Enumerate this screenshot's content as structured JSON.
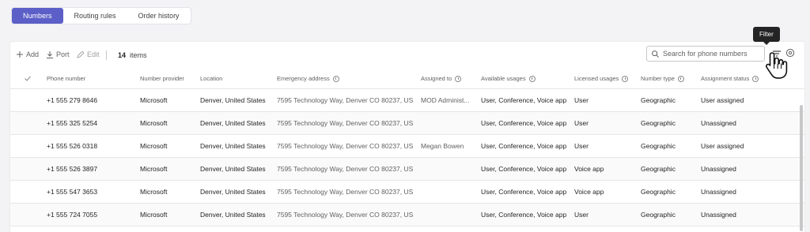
{
  "tabs": [
    {
      "label": "Numbers",
      "active": true
    },
    {
      "label": "Routing rules",
      "active": false
    },
    {
      "label": "Order history",
      "active": false
    }
  ],
  "toolbar": {
    "add_label": "Add",
    "port_label": "Port",
    "edit_label": "Edit",
    "item_count": "14",
    "items_label": "items",
    "search_placeholder": "Search for phone numbers",
    "filter_tooltip": "Filter"
  },
  "table": {
    "headers": {
      "phone": "Phone number",
      "provider": "Number provider",
      "location": "Location",
      "address": "Emergency address",
      "assigned": "Assigned to",
      "usages": "Available usages",
      "licensed": "Licensed usages",
      "type": "Number type",
      "status": "Assignment status"
    },
    "rows": [
      {
        "phone": "+1 555 279 8646",
        "provider": "Microsoft",
        "location": "Denver, United States",
        "address": "7595 Technology Way, Denver CO 80237, US,",
        "assigned": "MOD Administ...",
        "usages": "User, Conference, Voice app",
        "licensed": "User",
        "type": "Geographic",
        "status": "User assigned"
      },
      {
        "phone": "+1 555 325 5254",
        "provider": "Microsoft",
        "location": "Denver, United States",
        "address": "7595 Technology Way, Denver CO 80237, US,",
        "assigned": "",
        "usages": "User, Conference, Voice app",
        "licensed": "User",
        "type": "Geographic",
        "status": "Unassigned"
      },
      {
        "phone": "+1 555 526 0318",
        "provider": "Microsoft",
        "location": "Denver, United States",
        "address": "7595 Technology Way, Denver CO 80237, US,",
        "assigned": "Megan Bowen",
        "usages": "User, Conference, Voice app",
        "licensed": "User",
        "type": "Geographic",
        "status": "User assigned"
      },
      {
        "phone": "+1 555 526 3897",
        "provider": "Microsoft",
        "location": "Denver, United States",
        "address": "7595 Technology Way, Denver CO 80237, US,",
        "assigned": "",
        "usages": "User, Conference, Voice app",
        "licensed": "Voice app",
        "type": "Geographic",
        "status": "Unassigned"
      },
      {
        "phone": "+1 555 547 3653",
        "provider": "Microsoft",
        "location": "Denver, United States",
        "address": "7595 Technology Way, Denver CO 80237, US,",
        "assigned": "",
        "usages": "User, Conference, Voice app",
        "licensed": "Voice app",
        "type": "Geographic",
        "status": "Unassigned"
      },
      {
        "phone": "+1 555 724 7055",
        "provider": "Microsoft",
        "location": "Denver, United States",
        "address": "7595 Technology Way, Denver CO 80237, US,",
        "assigned": "",
        "usages": "User, Conference, Voice app",
        "licensed": "User",
        "type": "Geographic",
        "status": "Unassigned"
      }
    ]
  },
  "colors": {
    "accent": "#5b5fc7",
    "background": "#f3f3f6"
  }
}
